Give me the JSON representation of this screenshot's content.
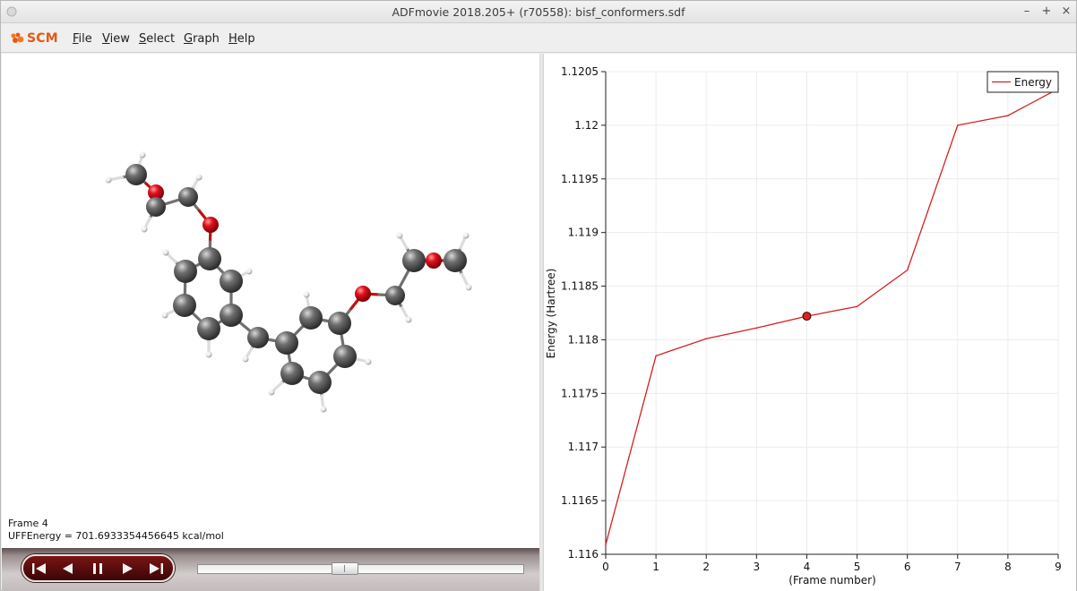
{
  "window": {
    "title": "ADFmovie 2018.205+ (r70558): bisf_conformers.sdf",
    "minimize_glyph": "–",
    "maximize_glyph": "+",
    "close_glyph": "×"
  },
  "menubar": {
    "logo_text": "SCM",
    "items": [
      {
        "label": "File"
      },
      {
        "label": "View"
      },
      {
        "label": "Select"
      },
      {
        "label": "Graph"
      },
      {
        "label": "Help"
      }
    ]
  },
  "molecule_view": {
    "frame_text": "Frame 4",
    "energy_text": "UFFEnergy = 701.6933354456645 kcal/mol",
    "atom_colors": {
      "C": "#5a5a5a",
      "O": "#e0101a",
      "H": "#f2f2f2"
    }
  },
  "playback": {
    "buttons": [
      "skip-to-start",
      "step-back",
      "pause",
      "step-forward",
      "skip-to-end"
    ],
    "slider_value": 4,
    "slider_max": 9
  },
  "chart_data": {
    "type": "line",
    "title": "",
    "xlabel": "(Frame number)",
    "ylabel": "Energy (Hartree)",
    "xlim": [
      0,
      9
    ],
    "ylim": [
      1.116,
      1.1205
    ],
    "x_ticks": [
      "0",
      "1",
      "2",
      "3",
      "4",
      "5",
      "6",
      "7",
      "8",
      "9"
    ],
    "y_ticks": [
      "1.116",
      "1.1165",
      "1.117",
      "1.1175",
      "1.118",
      "1.1185",
      "1.119",
      "1.1195",
      "1.12",
      "1.1205"
    ],
    "grid": true,
    "legend_position": "top-right",
    "series": [
      {
        "name": "Energy",
        "color": "#d42020",
        "x": [
          0,
          1,
          2,
          3,
          4,
          5,
          6,
          7,
          8,
          9
        ],
        "values": [
          1.11609,
          1.11785,
          1.11801,
          1.11811,
          1.11822,
          1.11831,
          1.11865,
          1.12,
          1.12009,
          1.12034
        ]
      }
    ],
    "selected_point": {
      "x": 4,
      "y": 1.11822
    }
  }
}
